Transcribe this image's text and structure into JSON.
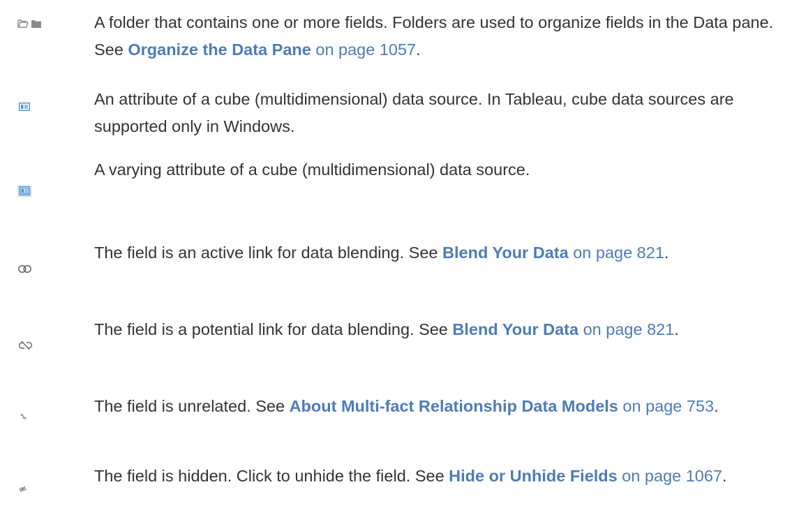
{
  "rows": [
    {
      "icons": [
        "folder-open-icon",
        "folder-icon"
      ],
      "text_before": "A folder that contains one or more fields. Folders are used to organize fields in the Data pane. See ",
      "link_title": "Organize the Data Pane",
      "link_page": " on page 1057",
      "text_after": "."
    },
    {
      "icons": [
        "cube-attribute-icon"
      ],
      "text_before": "An attribute of a cube (multidimensional) data source. In Tableau, cube data sources are supported only in Windows.",
      "link_title": "",
      "link_page": "",
      "text_after": ""
    },
    {
      "icons": [
        "varying-attribute-icon"
      ],
      "text_before": "A varying attribute of a cube (multidimensional) data source.",
      "link_title": "",
      "link_page": "",
      "text_after": ""
    },
    {
      "icons": [
        "active-link-icon"
      ],
      "text_before": "The field is an active link for data blending. See ",
      "link_title": "Blend Your Data",
      "link_page": " on page 821",
      "text_after": "."
    },
    {
      "icons": [
        "potential-link-icon"
      ],
      "text_before": "The field is a potential link for data blending. See ",
      "link_title": "Blend Your Data",
      "link_page": " on page 821",
      "text_after": "."
    },
    {
      "icons": [
        "unrelated-field-icon"
      ],
      "text_before": "The field is unrelated. See ",
      "link_title": "About Multi-fact Relationship Data Models",
      "link_page": " on page 753",
      "text_after": "."
    },
    {
      "icons": [
        "hidden-field-icon"
      ],
      "text_before": "The field is hidden. Click to unhide the field. See ",
      "link_title": "Hide or Unhide Fields",
      "link_page": " on page 1067",
      "text_after": "."
    }
  ],
  "colors": {
    "text": "#333333",
    "link": "#4e7bb6",
    "icon_gray": "#8a8a8a",
    "icon_blue": "#4f8fc9"
  }
}
